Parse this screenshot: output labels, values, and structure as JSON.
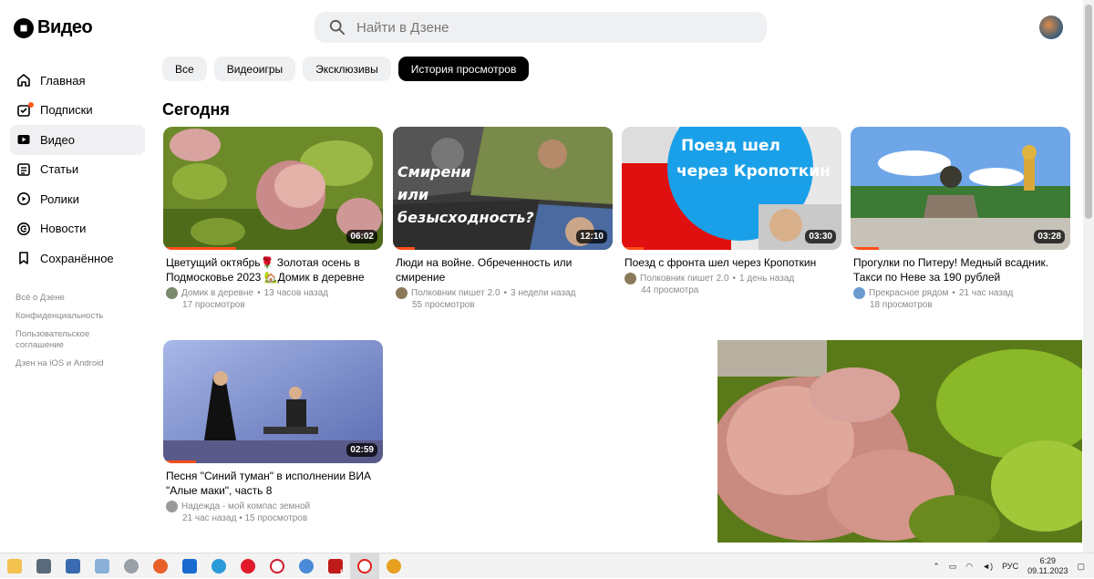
{
  "header": {
    "logo_text": "Видео",
    "search_placeholder": "Найти в Дзене"
  },
  "sidebar": {
    "items": [
      {
        "label": "Главная",
        "icon": "home-icon"
      },
      {
        "label": "Подписки",
        "icon": "subscriptions-icon"
      },
      {
        "label": "Видео",
        "icon": "video-icon"
      },
      {
        "label": "Статьи",
        "icon": "articles-icon"
      },
      {
        "label": "Ролики",
        "icon": "shorts-icon"
      },
      {
        "label": "Новости",
        "icon": "news-icon"
      },
      {
        "label": "Сохранённое",
        "icon": "bookmark-icon"
      }
    ],
    "footer": [
      "Всё о Дзене",
      "Конфиденциальность",
      "Пользовательское соглашение",
      "Дзен на iOS и Android"
    ]
  },
  "chips": [
    "Все",
    "Видеоигры",
    "Эксклюзивы",
    "История просмотров"
  ],
  "section_title": "Сегодня",
  "videos": [
    {
      "title": "Цветущий октябрь🌹 Золотая осень в Подмосковье 2023 🏡Домик в деревне",
      "channel": "Домик в деревне",
      "time": "13 часов назад",
      "views": "17 просмотров",
      "duration": "06:02",
      "progress": 0.33
    },
    {
      "title": "Люди на войне. Обреченность или смирение",
      "channel": "Полковник пишет 2.0",
      "time": "3 недели назад",
      "views": "55 просмотров",
      "duration": "12:10",
      "progress": 0.1,
      "overlay_text": "Смирение или безысходность?"
    },
    {
      "title": "Поезд с фронта шел через Кропоткин",
      "channel": "Полковник пишет 2.0",
      "time": "1 день назад",
      "views": "44 просмотра",
      "duration": "03:30",
      "progress": 0.1,
      "overlay_text": "Поезд шел через Кропоткин"
    },
    {
      "title": "Прогулки по Питеру! Медный всадник. Такси по Неве за 190 рублей",
      "channel": "Прекрасное рядом",
      "time": "21 час назад",
      "views": "18 просмотров",
      "duration": "03:28",
      "progress": 0.13
    },
    {
      "title": "Песня \"Синий туман\" в исполнении ВИА \"Алые маки\", часть 8",
      "channel": "Надежда - мой компас земной",
      "time": "21 час назад",
      "views": "15 просмотров",
      "duration": "02:59",
      "progress": 0.15
    }
  ],
  "taskbar": {
    "lang": "РУС",
    "time": "6:29",
    "date": "09.11.2023",
    "badge": "8"
  }
}
